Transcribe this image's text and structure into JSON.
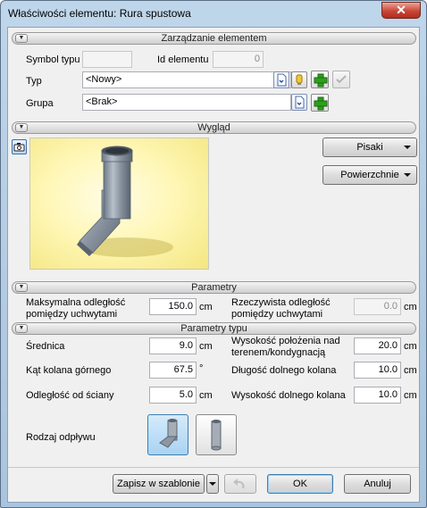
{
  "window": {
    "title": "Właściwości elementu: Rura spustowa",
    "close_glyph": "✕"
  },
  "sections": {
    "management": "Zarządzanie elementem",
    "appearance": "Wygląd",
    "parameters": "Parametry",
    "type_parameters": "Parametry typu"
  },
  "management": {
    "symbol_label": "Symbol typu",
    "symbol_value": "",
    "id_label": "Id elementu",
    "id_value": "0",
    "type_label": "Typ",
    "type_value": "<Nowy>",
    "group_label": "Grupa",
    "group_value": "<Brak>"
  },
  "appearance": {
    "pens_button": "Pisaki",
    "surfaces_button": "Powierzchnie"
  },
  "parameters": {
    "max_distance_label_1": "Maksymalna odległość",
    "max_distance_label_2": "pomiędzy uchwytami",
    "max_distance_value": "150.0",
    "max_distance_unit": "cm",
    "actual_distance_label_1": "Rzeczywista odległość",
    "actual_distance_label_2": "pomiędzy uchwytami",
    "actual_distance_value": "0.0",
    "actual_distance_unit": "cm"
  },
  "type_parameters": {
    "diameter_label": "Średnica",
    "diameter_value": "9.0",
    "diameter_unit": "cm",
    "upper_angle_label": "Kąt kolana górnego",
    "upper_angle_value": "67.5",
    "upper_angle_unit": "°",
    "wall_distance_label": "Odległość od ściany",
    "wall_distance_value": "5.0",
    "wall_distance_unit": "cm",
    "height_label_1": "Wysokość położenia nad",
    "height_label_2": "terenem/kondygnacją",
    "height_value": "20.0",
    "height_unit": "cm",
    "lower_length_label": "Długość dolnego kolana",
    "lower_length_value": "10.0",
    "lower_length_unit": "cm",
    "lower_height_label": "Wysokość dolnego kolana",
    "lower_height_value": "10.0",
    "lower_height_unit": "cm",
    "drain_label": "Rodzaj odpływu"
  },
  "footer": {
    "save_template": "Zapisz w szablonie",
    "ok": "OK",
    "cancel": "Anuluj"
  },
  "colors": {
    "title_bar": "#bfd6ea",
    "close_button": "#c8473a",
    "ok_border": "#3c7fb1",
    "selected_tile": "#a9d3f2",
    "add_icon": "#2f9e1e"
  }
}
